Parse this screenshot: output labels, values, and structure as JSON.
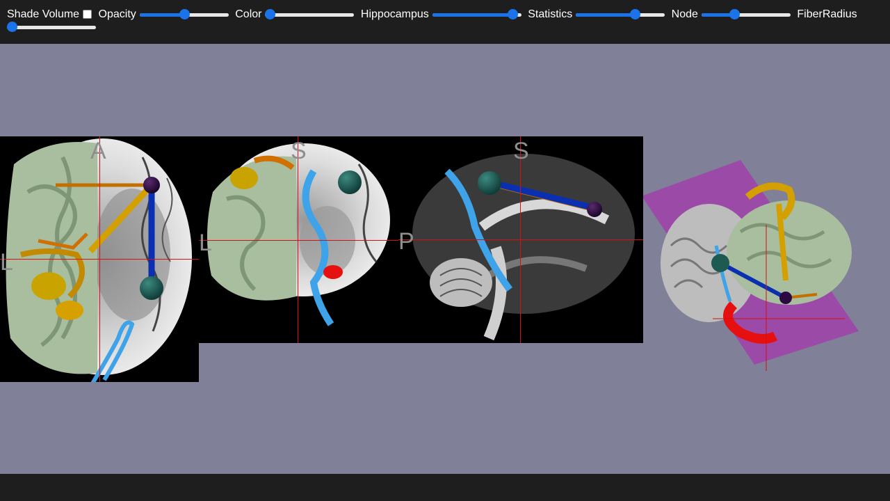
{
  "toolbar": {
    "shade_volume_label": "Shade Volume",
    "shade_volume_checked": false,
    "sliders": [
      {
        "label": "Opacity",
        "value": 0.5
      },
      {
        "label": "Color",
        "value": 0.0
      },
      {
        "label": "Hippocampus",
        "value": 0.95
      },
      {
        "label": "Statistics",
        "value": 0.68
      },
      {
        "label": "Node",
        "value": 0.35
      },
      {
        "label": "FiberRadius",
        "value": 0.0
      }
    ],
    "accent_color": "#1a73e8"
  },
  "viewer": {
    "background_color": "#808098",
    "axial": {
      "top": "A",
      "left": "L"
    },
    "coronal": {
      "top": "S",
      "left": "L"
    },
    "sagittal": {
      "top": "S",
      "left": "P"
    }
  }
}
